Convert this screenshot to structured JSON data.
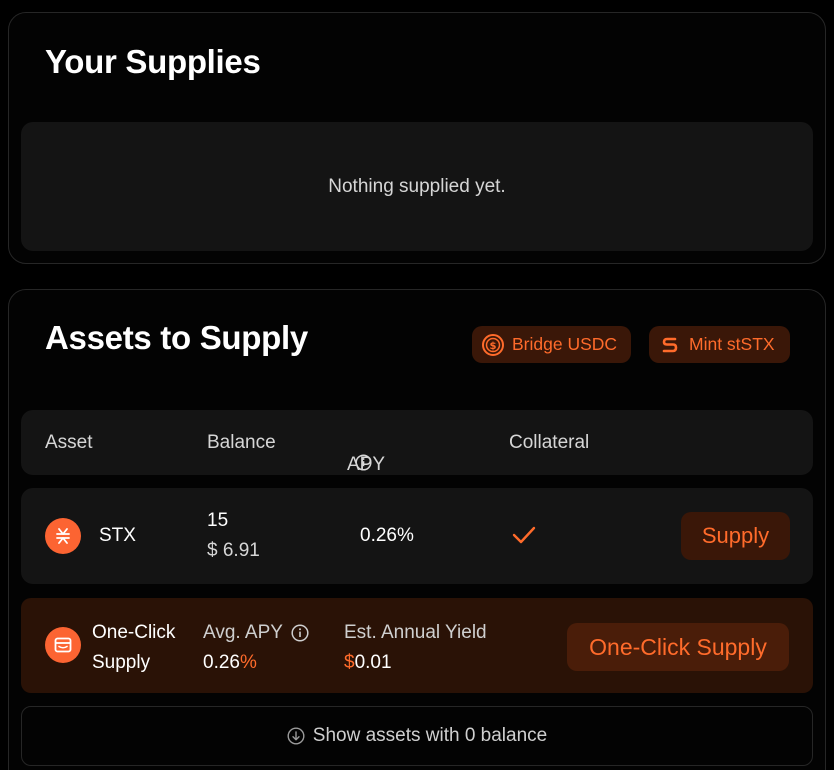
{
  "supplies": {
    "title": "Your Supplies",
    "empty_text": "Nothing supplied yet."
  },
  "assets": {
    "title": "Assets to Supply",
    "actions": [
      {
        "label": "Bridge USDC",
        "icon": "usdc-icon"
      },
      {
        "label": "Mint stSTX",
        "icon": "ststx-icon"
      }
    ],
    "columns": {
      "asset": "Asset",
      "balance": "Balance",
      "apy": "APY",
      "collateral": "Collateral"
    },
    "rows": [
      {
        "symbol": "STX",
        "icon": "stx-icon",
        "balance": "15",
        "balance_usd": "$ 6.91",
        "apy": "0.26%",
        "collateral": true,
        "action": "Supply"
      }
    ],
    "one_click": {
      "label_line1": "One-Click",
      "label_line2": "Supply",
      "icon": "wallet-icon",
      "avg_apy_label": "Avg. APY",
      "avg_apy_value": "0.26",
      "avg_apy_unit": "%",
      "yield_label": "Est. Annual Yield",
      "yield_currency": "$",
      "yield_value": "0.01",
      "button": "One-Click Supply"
    },
    "show_zero": "Show assets with 0 balance"
  },
  "colors": {
    "accent": "#ff6b2b",
    "accent_bg": "#3a1708",
    "card_bg": "#141414"
  }
}
